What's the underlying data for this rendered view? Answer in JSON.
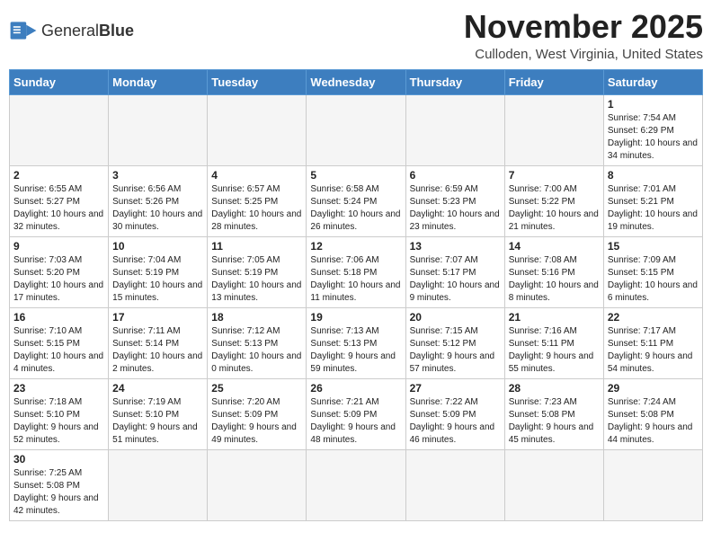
{
  "logo": {
    "text_general": "General",
    "text_blue": "Blue"
  },
  "title": "November 2025",
  "subtitle": "Culloden, West Virginia, United States",
  "headers": [
    "Sunday",
    "Monday",
    "Tuesday",
    "Wednesday",
    "Thursday",
    "Friday",
    "Saturday"
  ],
  "weeks": [
    [
      {
        "day": "",
        "info": ""
      },
      {
        "day": "",
        "info": ""
      },
      {
        "day": "",
        "info": ""
      },
      {
        "day": "",
        "info": ""
      },
      {
        "day": "",
        "info": ""
      },
      {
        "day": "",
        "info": ""
      },
      {
        "day": "1",
        "info": "Sunrise: 7:54 AM\nSunset: 6:29 PM\nDaylight: 10 hours and 34 minutes."
      }
    ],
    [
      {
        "day": "2",
        "info": "Sunrise: 6:55 AM\nSunset: 5:27 PM\nDaylight: 10 hours and 32 minutes."
      },
      {
        "day": "3",
        "info": "Sunrise: 6:56 AM\nSunset: 5:26 PM\nDaylight: 10 hours and 30 minutes."
      },
      {
        "day": "4",
        "info": "Sunrise: 6:57 AM\nSunset: 5:25 PM\nDaylight: 10 hours and 28 minutes."
      },
      {
        "day": "5",
        "info": "Sunrise: 6:58 AM\nSunset: 5:24 PM\nDaylight: 10 hours and 26 minutes."
      },
      {
        "day": "6",
        "info": "Sunrise: 6:59 AM\nSunset: 5:23 PM\nDaylight: 10 hours and 23 minutes."
      },
      {
        "day": "7",
        "info": "Sunrise: 7:00 AM\nSunset: 5:22 PM\nDaylight: 10 hours and 21 minutes."
      },
      {
        "day": "8",
        "info": "Sunrise: 7:01 AM\nSunset: 5:21 PM\nDaylight: 10 hours and 19 minutes."
      }
    ],
    [
      {
        "day": "9",
        "info": "Sunrise: 7:03 AM\nSunset: 5:20 PM\nDaylight: 10 hours and 17 minutes."
      },
      {
        "day": "10",
        "info": "Sunrise: 7:04 AM\nSunset: 5:19 PM\nDaylight: 10 hours and 15 minutes."
      },
      {
        "day": "11",
        "info": "Sunrise: 7:05 AM\nSunset: 5:19 PM\nDaylight: 10 hours and 13 minutes."
      },
      {
        "day": "12",
        "info": "Sunrise: 7:06 AM\nSunset: 5:18 PM\nDaylight: 10 hours and 11 minutes."
      },
      {
        "day": "13",
        "info": "Sunrise: 7:07 AM\nSunset: 5:17 PM\nDaylight: 10 hours and 9 minutes."
      },
      {
        "day": "14",
        "info": "Sunrise: 7:08 AM\nSunset: 5:16 PM\nDaylight: 10 hours and 8 minutes."
      },
      {
        "day": "15",
        "info": "Sunrise: 7:09 AM\nSunset: 5:15 PM\nDaylight: 10 hours and 6 minutes."
      }
    ],
    [
      {
        "day": "16",
        "info": "Sunrise: 7:10 AM\nSunset: 5:15 PM\nDaylight: 10 hours and 4 minutes."
      },
      {
        "day": "17",
        "info": "Sunrise: 7:11 AM\nSunset: 5:14 PM\nDaylight: 10 hours and 2 minutes."
      },
      {
        "day": "18",
        "info": "Sunrise: 7:12 AM\nSunset: 5:13 PM\nDaylight: 10 hours and 0 minutes."
      },
      {
        "day": "19",
        "info": "Sunrise: 7:13 AM\nSunset: 5:13 PM\nDaylight: 9 hours and 59 minutes."
      },
      {
        "day": "20",
        "info": "Sunrise: 7:15 AM\nSunset: 5:12 PM\nDaylight: 9 hours and 57 minutes."
      },
      {
        "day": "21",
        "info": "Sunrise: 7:16 AM\nSunset: 5:11 PM\nDaylight: 9 hours and 55 minutes."
      },
      {
        "day": "22",
        "info": "Sunrise: 7:17 AM\nSunset: 5:11 PM\nDaylight: 9 hours and 54 minutes."
      }
    ],
    [
      {
        "day": "23",
        "info": "Sunrise: 7:18 AM\nSunset: 5:10 PM\nDaylight: 9 hours and 52 minutes."
      },
      {
        "day": "24",
        "info": "Sunrise: 7:19 AM\nSunset: 5:10 PM\nDaylight: 9 hours and 51 minutes."
      },
      {
        "day": "25",
        "info": "Sunrise: 7:20 AM\nSunset: 5:09 PM\nDaylight: 9 hours and 49 minutes."
      },
      {
        "day": "26",
        "info": "Sunrise: 7:21 AM\nSunset: 5:09 PM\nDaylight: 9 hours and 48 minutes."
      },
      {
        "day": "27",
        "info": "Sunrise: 7:22 AM\nSunset: 5:09 PM\nDaylight: 9 hours and 46 minutes."
      },
      {
        "day": "28",
        "info": "Sunrise: 7:23 AM\nSunset: 5:08 PM\nDaylight: 9 hours and 45 minutes."
      },
      {
        "day": "29",
        "info": "Sunrise: 7:24 AM\nSunset: 5:08 PM\nDaylight: 9 hours and 44 minutes."
      }
    ],
    [
      {
        "day": "30",
        "info": "Sunrise: 7:25 AM\nSunset: 5:08 PM\nDaylight: 9 hours and 42 minutes."
      },
      {
        "day": "",
        "info": ""
      },
      {
        "day": "",
        "info": ""
      },
      {
        "day": "",
        "info": ""
      },
      {
        "day": "",
        "info": ""
      },
      {
        "day": "",
        "info": ""
      },
      {
        "day": "",
        "info": ""
      }
    ]
  ]
}
